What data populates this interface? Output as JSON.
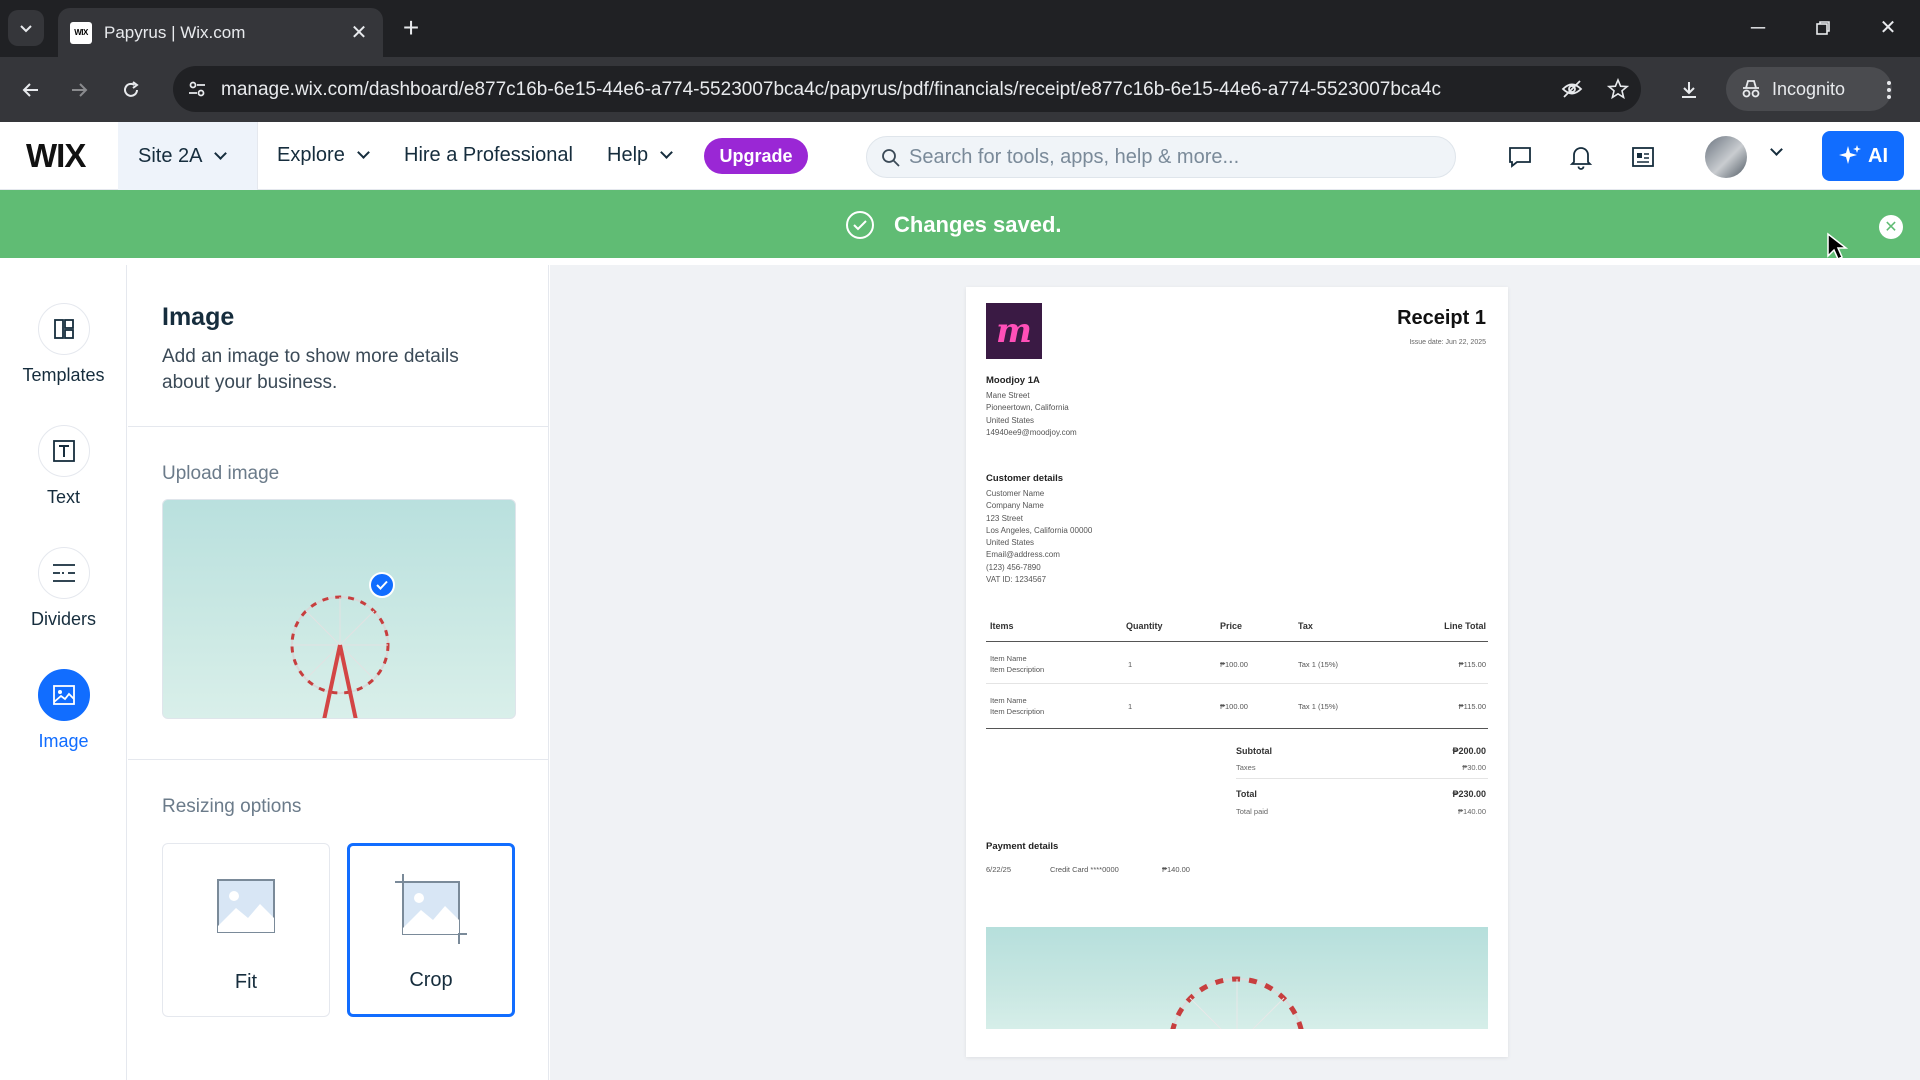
{
  "browser": {
    "tab_title": "Papyrus | Wix.com",
    "tab_favicon_text": "WIX",
    "url": "manage.wix.com/dashboard/e877c16b-6e15-44e6-a774-5523007bca4c/papyrus/pdf/financials/receipt/e877c16b-6e15-44e6-a774-5523007bca4c",
    "incognito_label": "Incognito"
  },
  "wix_header": {
    "logo": "WIX",
    "site_name": "Site 2A",
    "explore": "Explore",
    "hire": "Hire a Professional",
    "help": "Help",
    "upgrade": "Upgrade",
    "search_placeholder": "Search for tools, apps, help & more...",
    "ai_label": "AI"
  },
  "toast": {
    "message": "Changes saved.",
    "color": "#60bc74"
  },
  "rail": {
    "items": [
      {
        "label": "Templates",
        "icon": "templates-icon"
      },
      {
        "label": "Text",
        "icon": "text-icon"
      },
      {
        "label": "Dividers",
        "icon": "dividers-icon"
      },
      {
        "label": "Image",
        "icon": "image-icon",
        "active": true
      }
    ]
  },
  "panel": {
    "title": "Image",
    "description": "Add an image to show more details about your business.",
    "upload_label": "Upload image",
    "resizing_label": "Resizing options",
    "options": [
      {
        "label": "Fit",
        "selected": false
      },
      {
        "label": "Crop",
        "selected": true
      }
    ]
  },
  "receipt": {
    "logo_letter": "m",
    "title": "Receipt 1",
    "issue_date": "Issue date: Jun 22, 2025",
    "business": {
      "name": "Moodjoy 1A",
      "street": "Mane Street",
      "city": "Pioneertown, California",
      "country": "United States",
      "email": "14940ee9@moodjoy.com"
    },
    "customer": {
      "heading": "Customer details",
      "name": "Customer Name",
      "company": "Company Name",
      "street": "123 Street",
      "city": "Los Angeles, California 00000",
      "country": "United States",
      "email": "Email@address.com",
      "phone": "(123) 456-7890",
      "vat": "VAT ID: 1234567"
    },
    "table": {
      "headers": [
        "Items",
        "Quantity",
        "Price",
        "Tax",
        "Line Total"
      ],
      "rows": [
        {
          "name": "Item Name",
          "desc": "Item Description",
          "qty": "1",
          "price": "₱100.00",
          "tax": "Tax 1 (15%)",
          "total": "₱115.00"
        },
        {
          "name": "Item Name",
          "desc": "Item Description",
          "qty": "1",
          "price": "₱100.00",
          "tax": "Tax 1 (15%)",
          "total": "₱115.00"
        }
      ]
    },
    "summary": {
      "subtotal_label": "Subtotal",
      "subtotal": "₱200.00",
      "taxes_label": "Taxes",
      "taxes": "₱30.00",
      "total_label": "Total",
      "total": "₱230.00",
      "paid_label": "Total paid",
      "paid": "₱140.00"
    },
    "payment": {
      "heading": "Payment details",
      "date": "6/22/25",
      "method": "Credit Card ****0000",
      "amount": "₱140.00"
    }
  },
  "colors": {
    "accent": "#116dff",
    "upgrade": "#9a27d5",
    "logo_bg": "#3a1a44",
    "logo_fg": "#ff4fb8"
  }
}
